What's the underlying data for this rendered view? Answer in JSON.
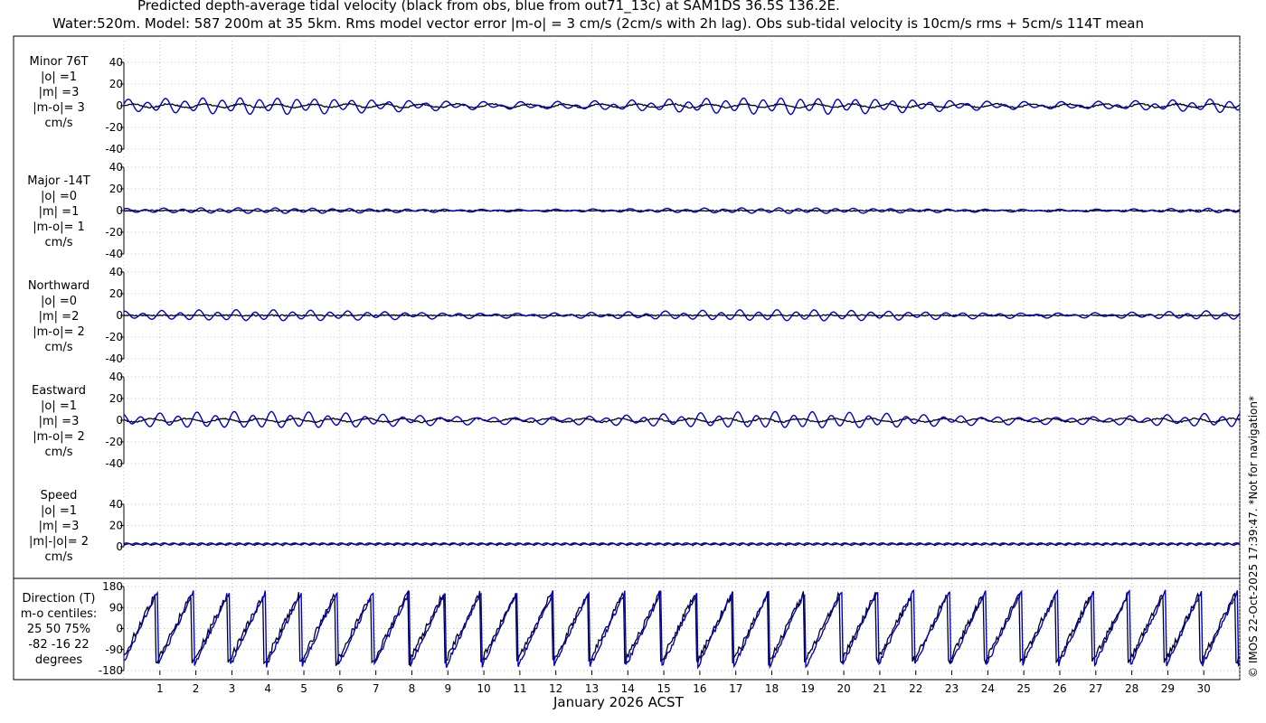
{
  "title": {
    "line1": "Predicted depth-average tidal velocity (black from obs, blue from out71_13c) at SAM1DS 36.5S 136.2E.",
    "line2": "Water:520m. Model: 587 200m at 35 5km. Rms model vector error |m-o| = 3 cm/s (2cm/s with 2h lag). Obs sub-tidal velocity is 10cm/s rms + 5cm/s 114T mean"
  },
  "credit": "© IMOS 22-Oct-2025 17:39:47. *Not for navigation*",
  "colors": {
    "obs": "#000000",
    "model": "#0000cc",
    "grid": "#b0b0b0"
  },
  "chart_data": {
    "type": "line",
    "xlabel": "January 2026 ACST",
    "x_tick_labels": [
      "1",
      "2",
      "3",
      "4",
      "5",
      "6",
      "7",
      "8",
      "9",
      "10",
      "11",
      "12",
      "13",
      "14",
      "15",
      "16",
      "17",
      "18",
      "19",
      "20",
      "21",
      "22",
      "23",
      "24",
      "25",
      "26",
      "27",
      "28",
      "29",
      "30"
    ],
    "grid": true,
    "series_legend": [
      "obs (black)",
      "out71_13c (blue)"
    ],
    "panels": [
      {
        "key": "minor",
        "label": [
          "Minor 76T",
          "|o| =1",
          "|m| =3",
          "|m-o|= 3",
          "cm/s"
        ],
        "ylim": [
          -40,
          40
        ],
        "yticks": [
          -40,
          -20,
          0,
          20,
          40
        ],
        "obs_amp": 1,
        "model_amp": 3
      },
      {
        "key": "major",
        "label": [
          "Major -14T",
          "|o| =0",
          "|m| =1",
          "|m-o|= 1",
          "cm/s"
        ],
        "ylim": [
          -40,
          40
        ],
        "yticks": [
          -40,
          -20,
          0,
          20,
          40
        ],
        "obs_amp": 0,
        "model_amp": 1
      },
      {
        "key": "north",
        "label": [
          "Northward",
          "|o| =0",
          "|m| =2",
          "|m-o|= 2",
          "cm/s"
        ],
        "ylim": [
          -40,
          40
        ],
        "yticks": [
          -40,
          -20,
          0,
          20,
          40
        ],
        "obs_amp": 0,
        "model_amp": 2
      },
      {
        "key": "east",
        "label": [
          "Eastward",
          "|o| =1",
          "|m| =3",
          "|m-o|= 2",
          "cm/s"
        ],
        "ylim": [
          -40,
          40
        ],
        "yticks": [
          -40,
          -20,
          0,
          20,
          40
        ],
        "obs_amp": 1,
        "model_amp": 3
      },
      {
        "key": "speed",
        "label": [
          "Speed",
          "|o| =1",
          "|m| =3",
          "|m|-|o|= 2",
          "cm/s"
        ],
        "ylim": [
          0,
          40
        ],
        "yticks": [
          0,
          20,
          40
        ],
        "obs_amp": 1,
        "model_amp": 3
      },
      {
        "key": "direction",
        "label": [
          "Direction (T)",
          "m-o centiles:",
          "25  50  75%",
          "-82 -16  22",
          "degrees"
        ],
        "ylim": [
          -180,
          180
        ],
        "yticks": [
          -180,
          -90,
          0,
          90,
          180
        ]
      }
    ]
  }
}
